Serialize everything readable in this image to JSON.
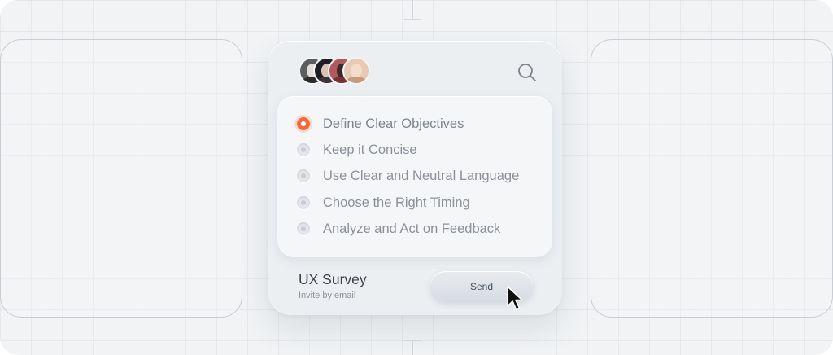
{
  "survey": {
    "avatars": [
      {
        "name": "avatar-1"
      },
      {
        "name": "avatar-2"
      },
      {
        "name": "avatar-3"
      },
      {
        "name": "avatar-4"
      }
    ],
    "search_icon": "search-icon",
    "options": [
      {
        "label": "Define Clear Objectives",
        "selected": true
      },
      {
        "label": "Keep it Concise",
        "selected": false
      },
      {
        "label": "Use Clear and Neutral Language",
        "selected": false
      },
      {
        "label": "Choose the Right Timing",
        "selected": false
      },
      {
        "label": "Analyze and Act on Feedback",
        "selected": false
      }
    ],
    "title": "UX Survey",
    "subtitle": "Invite by email",
    "send_label": "Send"
  },
  "colors": {
    "accent": "#f26a3d",
    "background": "#f1f3f5",
    "card": "#eceff2",
    "text_muted": "#8b9098"
  },
  "cursor_icon": "arrow-cursor-icon"
}
